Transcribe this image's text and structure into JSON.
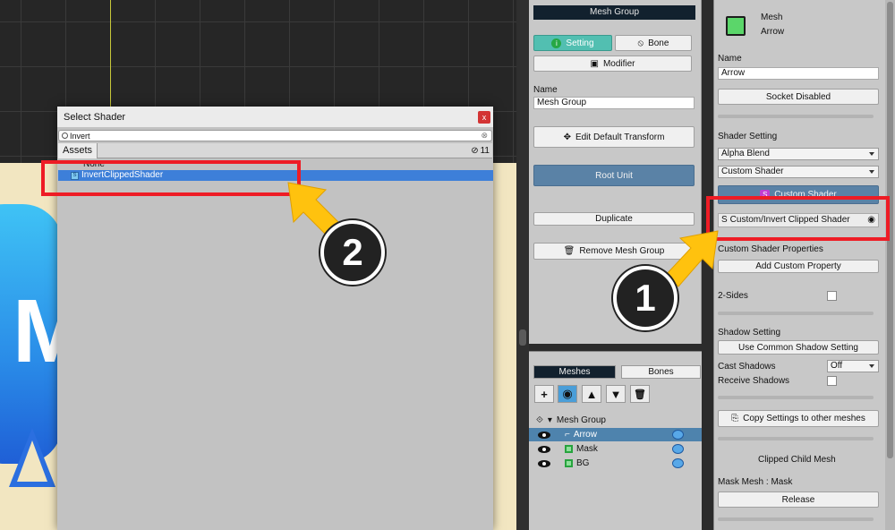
{
  "dialog": {
    "title": "Select Shader",
    "close_label": "x",
    "search_value": "Invert",
    "search_clear": "⊗",
    "tab_assets": "Assets",
    "hidden_count": "11",
    "items": [
      "None",
      "InvertClippedShader"
    ]
  },
  "mesh_group_panel": {
    "header": "Mesh Group",
    "setting_label": "Setting",
    "bone_label": "Bone",
    "modifier_label": "Modifier",
    "name_label": "Name",
    "name_value": "Mesh Group",
    "edit_default_transform_label": "Edit Default Transform",
    "root_unit_label": "Root Unit",
    "duplicate_label": "Duplicate",
    "remove_mesh_group_label": "Remove Mesh Group"
  },
  "mesh_list": {
    "tab_meshes": "Meshes",
    "tab_bones": "Bones",
    "group_name": "Mesh Group",
    "items": [
      "Arrow",
      "Mask",
      "BG"
    ]
  },
  "inspector": {
    "type_label": "Mesh",
    "object_name": "Arrow",
    "name_label": "Name",
    "name_value": "Arrow",
    "socket_label": "Socket Disabled",
    "shader_setting_label": "Shader Setting",
    "blend_mode": "Alpha Blend",
    "shader_type": "Custom Shader",
    "custom_shader_button": "Custom Shader",
    "shader_asset": "Custom/Invert Clipped Shader",
    "custom_props_label": "Custom Shader Properties",
    "add_custom_property_label": "Add Custom Property",
    "two_sides_label": "2-Sides",
    "shadow_setting_label": "Shadow Setting",
    "use_common_shadow_label": "Use Common Shadow Setting",
    "cast_shadows_label": "Cast Shadows",
    "cast_shadows_value": "Off",
    "receive_shadows_label": "Receive Shadows",
    "copy_settings_label": "Copy Settings to other meshes",
    "clipped_child_label": "Clipped Child Mesh",
    "mask_mesh_label": "Mask Mesh : Mask",
    "release_label": "Release"
  },
  "annotations": {
    "step1": "1",
    "step2": "2",
    "highlight_color": "#ee1c25",
    "arrow_color": "#ffc20e"
  }
}
